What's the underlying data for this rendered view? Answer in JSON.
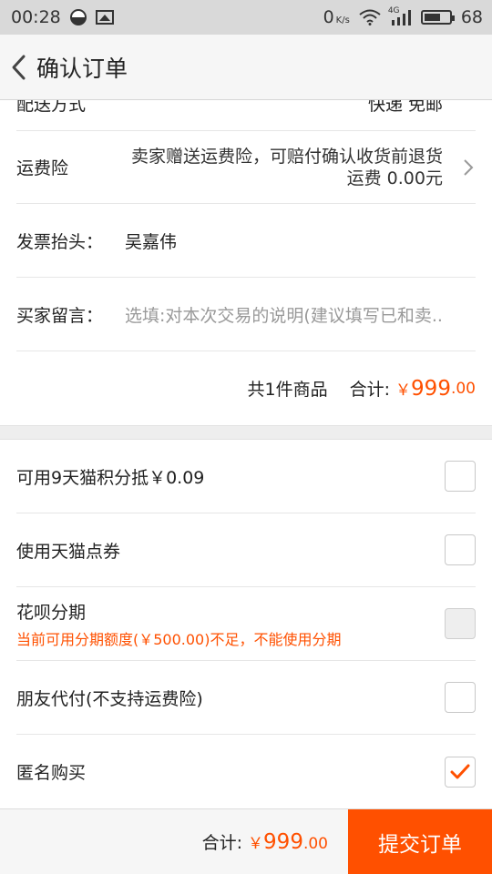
{
  "status_bar": {
    "time": "00:28",
    "net_speed_value": "0",
    "net_speed_unit": "K/s",
    "signal_label": "4G",
    "battery": "68",
    "battery_level": 0.68
  },
  "header": {
    "title": "确认订单"
  },
  "order": {
    "partial_row_label": "配送方式",
    "partial_row_value": "快递 免邮",
    "insurance_label": "运费险",
    "insurance_line1": "卖家赠送运费险，可赔付确认收货前退货",
    "insurance_line2": "运费 0.00元",
    "invoice_label": "发票抬头：",
    "invoice_value": "吴嘉伟",
    "message_label": "买家留言：",
    "message_placeholder": "选填:对本次交易的说明(建议填写已和卖..",
    "total_count": "共1件商品",
    "total_label": "合计:",
    "total_yuan": "￥",
    "total_int": "999",
    "total_dec": ".00"
  },
  "options": [
    {
      "label": "可用9天猫积分抵￥0.09",
      "checked": false,
      "disabled": false
    },
    {
      "label": "使用天猫点券",
      "checked": false,
      "disabled": false
    },
    {
      "label": "花呗分期",
      "warning": "当前可用分期额度(￥500.00)不足，不能使用分期",
      "checked": false,
      "disabled": true
    },
    {
      "label": "朋友代付(不支持运费险)",
      "checked": false,
      "disabled": false
    },
    {
      "label": "匿名购买",
      "checked": true,
      "disabled": false
    }
  ],
  "footer": {
    "total_label": "合计:",
    "total_yuan": "￥",
    "total_int": "999",
    "total_dec": ".00",
    "submit_label": "提交订单"
  },
  "colors": {
    "accent": "#ff5000",
    "status_bar_bg": "#d9d9d9",
    "page_bg": "#f2f2f2"
  }
}
